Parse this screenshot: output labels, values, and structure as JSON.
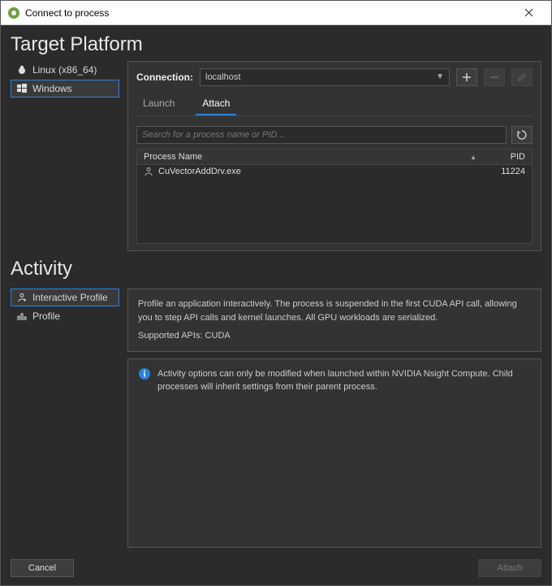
{
  "window": {
    "title": "Connect to process"
  },
  "sections": {
    "target": "Target Platform",
    "activity": "Activity"
  },
  "platforms": [
    {
      "label": "Linux (x86_64)",
      "selected": false,
      "icon": "linux-icon"
    },
    {
      "label": "Windows",
      "selected": true,
      "icon": "windows-icon"
    }
  ],
  "connection": {
    "label": "Connection:",
    "value": "localhost"
  },
  "connTabs": [
    {
      "label": "Launch",
      "active": false
    },
    {
      "label": "Attach",
      "active": true
    }
  ],
  "search": {
    "placeholder": "Search for a process name or PID..."
  },
  "table": {
    "headers": {
      "name": "Process Name",
      "pid": "PID"
    },
    "rows": [
      {
        "name": "CuVectorAddDrv.exe",
        "pid": "11224"
      }
    ]
  },
  "activities": [
    {
      "label": "Interactive Profile",
      "selected": true,
      "icon": "interactive-profile-icon"
    },
    {
      "label": "Profile",
      "selected": false,
      "icon": "profile-icon"
    }
  ],
  "activityDesc": {
    "text": "Profile an application interactively. The process is suspended in the first CUDA API call, allowing you to step API calls and kernel launches. All GPU workloads are serialized.",
    "supported": "Supported APIs: CUDA"
  },
  "activityInfo": "Activity options can only be modified when launched within NVIDIA Nsight Compute. Child processes will inherit settings from their parent process.",
  "buttons": {
    "cancel": "Cancel",
    "attach": "Attach"
  }
}
